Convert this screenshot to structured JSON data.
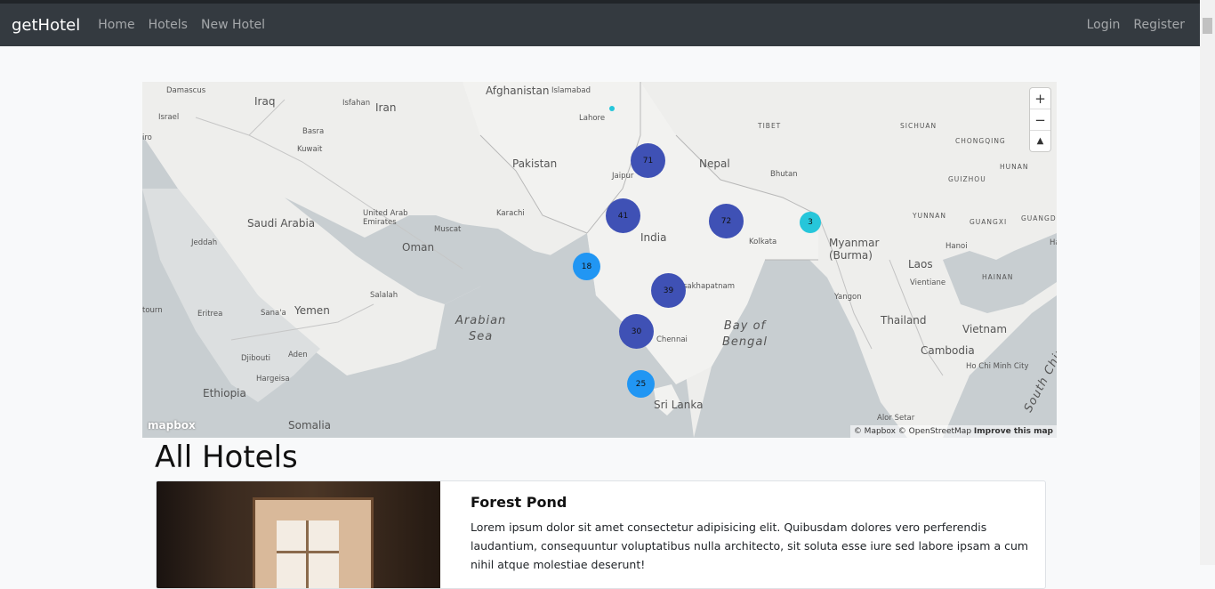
{
  "navbar": {
    "brand": "getHotel",
    "links": [
      "Home",
      "Hotels",
      "New Hotel"
    ],
    "right_links": [
      "Login",
      "Register"
    ]
  },
  "map": {
    "controls": {
      "zoom_in": "+",
      "zoom_out": "−",
      "compass": "▲"
    },
    "clusters": [
      {
        "count": "71"
      },
      {
        "count": "41"
      },
      {
        "count": "72"
      },
      {
        "count": "3"
      },
      {
        "count": "18"
      },
      {
        "count": "39"
      },
      {
        "count": "30"
      },
      {
        "count": "25"
      }
    ],
    "labels": {
      "damascus": "Damascus",
      "iraq": "Iraq",
      "isfahan": "Isfahan",
      "iran": "Iran",
      "israel": "Israel",
      "basra": "Basra",
      "kuwait": "Kuwait",
      "afghanistan": "Afghanistan",
      "islamabad": "Islamabad",
      "lahore": "Lahore",
      "pakistan": "Pakistan",
      "jaipur": "Jaipur",
      "nepal": "Nepal",
      "bhutan": "Bhutan",
      "saudi_arabia": "Saudi Arabia",
      "uae": "United Arab\nEmirates",
      "muscat": "Muscat",
      "karachi": "Karachi",
      "oman": "Oman",
      "india": "India",
      "kolkata": "Kolkata",
      "myanmar": "Myanmar\n(Burma)",
      "laos": "Laos",
      "hanoi": "Hanoi",
      "jeddah": "Jeddah",
      "salalah": "Salalah",
      "yemen": "Yemen",
      "sanaa": "Sana'a",
      "eritrea": "Eritrea",
      "arabian_sea": "Arabian\nSea",
      "visakhapatnam": "sakhapatnam",
      "bay_of_bengal": "Bay of\nBengal",
      "yangon": "Yangon",
      "thailand": "Thailand",
      "vietnam": "Vietnam",
      "chennai": "Chennai",
      "djibouti": "Djibouti",
      "aden": "Aden",
      "cambodia": "Cambodia",
      "hargeisa": "Hargeisa",
      "ethiopia": "Ethiopia",
      "ho_chi_minh": "Ho Chi Minh City",
      "sri_lanka": "Sri Lanka",
      "somalia": "Somalia",
      "south_china": "South China",
      "alor_setar": "Alor Setar",
      "sichuan": "SICHUAN",
      "chongqing": "CHONGQING",
      "guizhou": "GUIZHOU",
      "hunan": "HUNAN",
      "yunnan": "YUNNAN",
      "guangxi": "GUANGXI",
      "guangdong": "GUANGDO",
      "hainan": "HAINAN",
      "tibet": "TIBET",
      "vientiane": "Vientiane",
      "haiphong": "Ha",
      "toum": "tourn",
      "iro": "iro"
    },
    "logo": "mapbox",
    "attribution": "© Mapbox © OpenStreetMap",
    "improve": "Improve this map"
  },
  "page_title": "All Hotels",
  "hotel_card": {
    "title": "Forest Pond",
    "text": "Lorem ipsum dolor sit amet consectetur adipisicing elit. Quibusdam dolores vero perferendis laudantium, consequuntur voluptatibus nulla architecto, sit soluta esse iure sed labore ipsam a cum nihil atque molestiae deserunt!"
  }
}
